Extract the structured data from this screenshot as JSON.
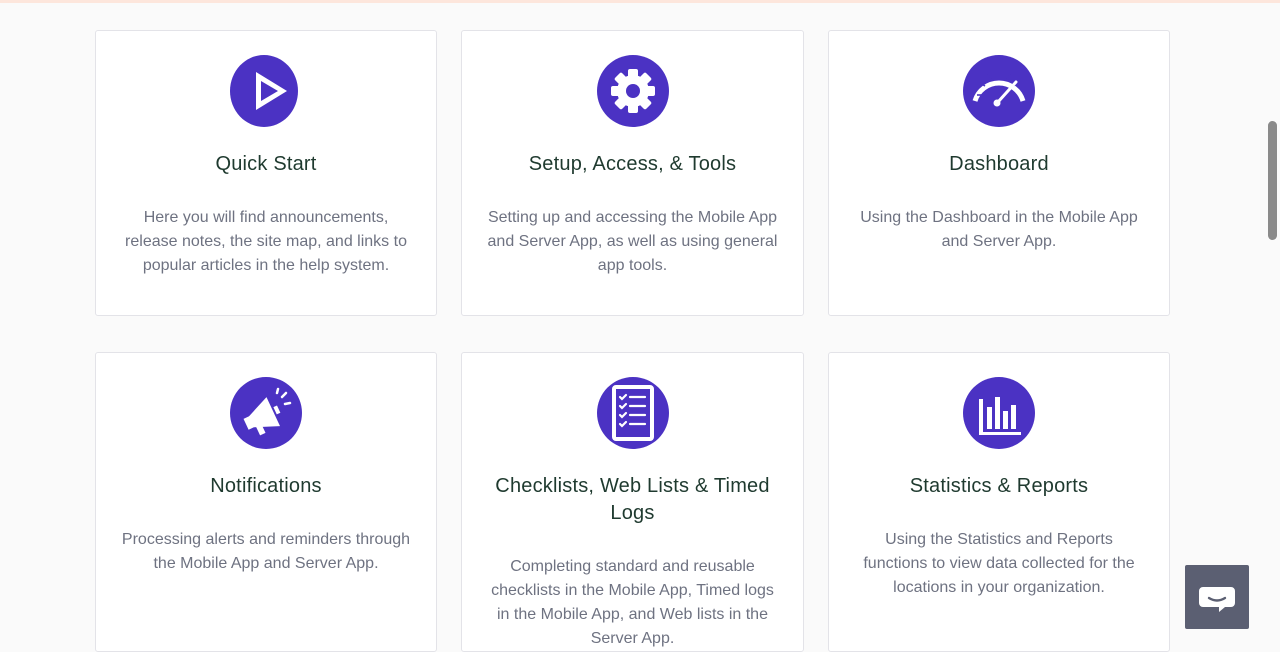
{
  "cards": [
    {
      "title": "Quick Start",
      "description": "Here you will find announcements, release notes, the site map, and links to popular articles in the help system.",
      "icon": "play-icon"
    },
    {
      "title": "Setup, Access, & Tools",
      "description": "Setting up and accessing the Mobile App and Server App, as well as using general app tools.",
      "icon": "gear-icon"
    },
    {
      "title": "Dashboard",
      "description": "Using the Dashboard in the Mobile App and Server App.",
      "icon": "speedometer-icon"
    },
    {
      "title": "Notifications",
      "description": "Processing alerts and reminders through the Mobile App and Server App.",
      "icon": "megaphone-icon"
    },
    {
      "title": "Checklists, Web Lists & Timed Logs",
      "description": "Completing standard and reusable checklists in the Mobile App, Timed logs in the Mobile App, and Web lists in the Server App.",
      "icon": "checklist-icon"
    },
    {
      "title": "Statistics & Reports",
      "description": "Using the Statistics and Reports functions to view data collected for the locations in your organization.",
      "icon": "bar-chart-icon"
    }
  ],
  "chat_widget": {
    "icon": "chat-bubble-icon"
  },
  "colors": {
    "icon_circle": "#4b32c3",
    "title": "#1f3a2f",
    "description": "#6e7281",
    "chat_button": "#5b5f72"
  }
}
